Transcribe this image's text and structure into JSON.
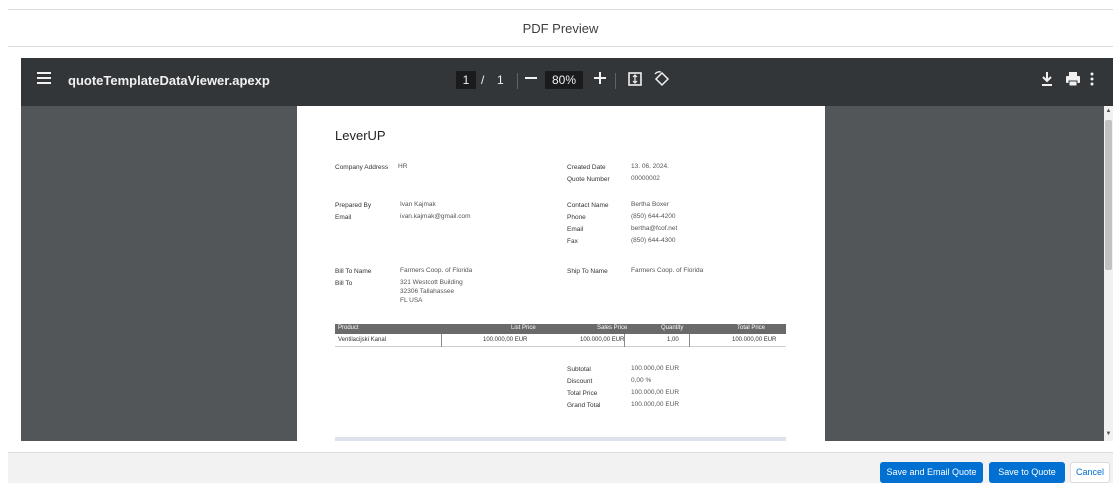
{
  "modal": {
    "title": "PDF Preview"
  },
  "viewer": {
    "filename": "quoteTemplateDataViewer.apexp",
    "page_current": "1",
    "page_separator": "/",
    "page_total": "1",
    "zoom": "80%",
    "icons": [
      "menu-icon",
      "zoom-out-icon",
      "zoom-in-icon",
      "fit-page-icon",
      "rotate-icon",
      "download-icon",
      "print-icon",
      "more-options-icon"
    ]
  },
  "document": {
    "company_name": "LeverUP",
    "company_address_label": "Company Address",
    "company_address_value": "HR",
    "created_date_label": "Created Date",
    "created_date_value": "13. 06. 2024.",
    "quote_number_label": "Quote Number",
    "quote_number_value": "00000002",
    "prepared_by_label": "Prepared By",
    "prepared_by_value": "Ivan Kajmak",
    "email_label": "Email",
    "email_value": "ivan.kajmak@gmail.com",
    "contact_name_label": "Contact Name",
    "contact_name_value": "Bertha Boxer",
    "phone_label": "Phone",
    "phone_value": "(850) 644-4200",
    "contact_email_label": "Email",
    "contact_email_value": "bertha@fcof.net",
    "fax_label": "Fax",
    "fax_value": "(850) 644-4300",
    "bill_to_name_label": "Bill To Name",
    "bill_to_name_value": "Farmers Coop. of Florida",
    "bill_to_label": "Bill To",
    "bill_to_line1": "321 Westcott Building",
    "bill_to_line2": "32306 Tallahassee",
    "bill_to_line3": "FL USA",
    "ship_to_name_label": "Ship To Name",
    "ship_to_name_value": "Farmers Coop. of Florida",
    "table": {
      "headers": [
        "Product",
        "List Price",
        "Sales Price",
        "Quantity",
        "Total Price"
      ],
      "rows": [
        [
          "Ventilacijski Kanal",
          "100.000,00 EUR",
          "100.000,00 EUR",
          "1,00",
          "100.000,00 EUR"
        ]
      ]
    },
    "totals": {
      "subtotal_label": "Subtotal",
      "subtotal_value": "100.000,00 EUR",
      "discount_label": "Discount",
      "discount_value": "0,00 %",
      "total_price_label": "Total Price",
      "total_price_value": "100.000,00 EUR",
      "grand_total_label": "Grand Total",
      "grand_total_value": "100.000,00 EUR"
    }
  },
  "footer": {
    "save_email_label": "Save and Email Quote",
    "save_label": "Save to Quote",
    "cancel_label": "Cancel"
  },
  "colors": {
    "brand": "#0070d2",
    "toolbar": "#323639",
    "viewer_bg": "#525659"
  }
}
